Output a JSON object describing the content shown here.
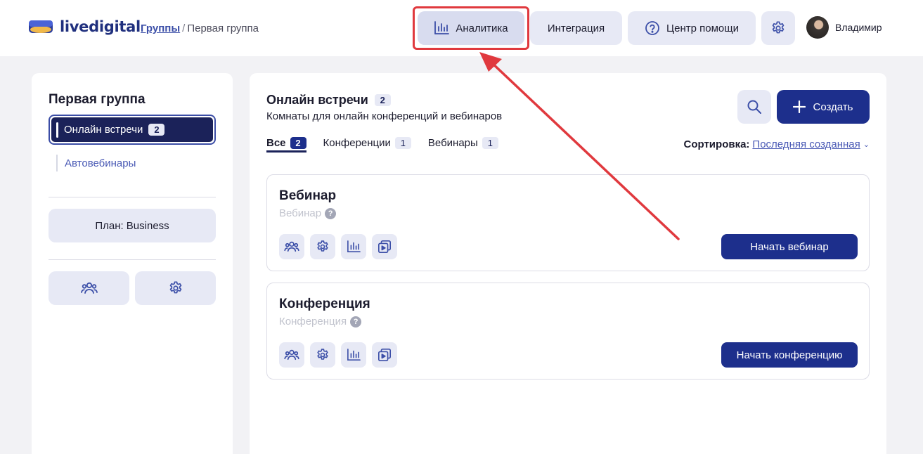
{
  "header": {
    "logo_text": "livedigital",
    "breadcrumb": {
      "link": "Группы",
      "separator": "/",
      "current": "Первая группа"
    },
    "nav": {
      "analytics_label": "Аналитика",
      "integration_label": "Интеграция",
      "help_label": "Центр помощи"
    },
    "icons": {
      "analytics": "bar-chart-icon",
      "help": "question-circle-icon",
      "settings": "gear-icon"
    },
    "user": {
      "name": "Владимир"
    }
  },
  "sidebar": {
    "title": "Первая группа",
    "items": [
      {
        "label": "Онлайн встречи",
        "count": "2",
        "active": true
      },
      {
        "label": "Автовебинары",
        "active": false
      }
    ],
    "plan_label": "План: Business",
    "bottom_icons": [
      "users-icon",
      "gear-icon"
    ]
  },
  "main": {
    "title": "Онлайн встречи",
    "title_count": "2",
    "subtitle": "Комнаты для онлайн конференций и вебинаров",
    "create_label": "Создать",
    "tabs": [
      {
        "label": "Все",
        "count": "2",
        "active": true
      },
      {
        "label": "Конференции",
        "count": "1",
        "active": false
      },
      {
        "label": "Вебинары",
        "count": "1",
        "active": false
      }
    ],
    "sort": {
      "label": "Сортировка:",
      "value": "Последняя созданная"
    },
    "cards": [
      {
        "title": "Вебинар",
        "type": "Вебинар",
        "action_label": "Начать вебинар"
      },
      {
        "title": "Конференция",
        "type": "Конференция",
        "action_label": "Начать конференцию"
      }
    ],
    "card_icons": [
      "users-icon",
      "gear-icon",
      "bar-chart-icon",
      "media-icon"
    ]
  },
  "annotation": {
    "color": "#e0393e"
  },
  "colors": {
    "brand": "#1d2f8c",
    "accent_dark": "#1b2259",
    "button_bg": "#e7e9f5"
  }
}
